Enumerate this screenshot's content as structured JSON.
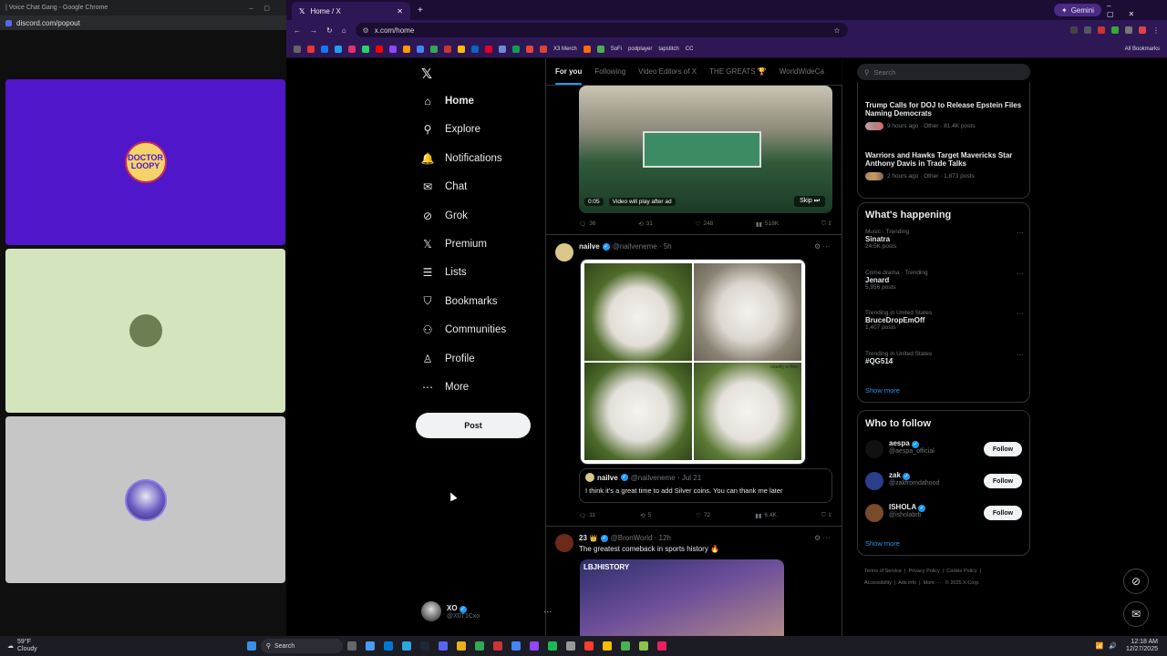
{
  "discord": {
    "title": "| Voice Chat Gang - Google Chrome",
    "url": "discord.com/popout",
    "tiles": [
      {
        "color": "#5016c9",
        "label": "DOCTOR LOOPY"
      },
      {
        "color": "#d4e4bc",
        "label": ""
      },
      {
        "color": "#c6c6c6",
        "label": ""
      }
    ]
  },
  "chrome": {
    "tab_title": "Home / X",
    "url": "x.com/home",
    "gemini_label": "Gemini",
    "bookmarks": [
      "X3 Merch",
      "SoFi",
      "podplayer",
      "tapstitch",
      "CC",
      "All Bookmarks"
    ]
  },
  "x": {
    "nav": [
      {
        "label": "Home",
        "icon": "home-icon"
      },
      {
        "label": "Explore",
        "icon": "search-icon"
      },
      {
        "label": "Notifications",
        "icon": "bell-icon"
      },
      {
        "label": "Chat",
        "icon": "mail-icon"
      },
      {
        "label": "Grok",
        "icon": "grok-icon"
      },
      {
        "label": "Premium",
        "icon": "x-logo-icon"
      },
      {
        "label": "Lists",
        "icon": "list-icon"
      },
      {
        "label": "Bookmarks",
        "icon": "bookmark-icon"
      },
      {
        "label": "Communities",
        "icon": "people-icon"
      },
      {
        "label": "Profile",
        "icon": "person-icon"
      },
      {
        "label": "More",
        "icon": "more-icon"
      }
    ],
    "post_button": "Post",
    "account": {
      "name": "XO",
      "handle": "@X0T1Cxo"
    },
    "feed_tabs": [
      "For you",
      "Following",
      "Video Editors of X",
      "THE GREATS 🏆",
      "WorldWideCa"
    ],
    "post1": {
      "video_time": "0:05",
      "video_note": "Video will play after ad",
      "skip": "Skip",
      "replies": "36",
      "reposts": "31",
      "likes": "248",
      "views": "518K"
    },
    "post2": {
      "name": "nailve",
      "handle": "@nailveneme · 5h",
      "watermark": "cruelty is free",
      "quote_name": "nailve",
      "quote_handle": "@nailveneme · Jul 21",
      "quote_text": "I think it's a great time to add Silver coins. You can thank me later",
      "replies": "11",
      "reposts": "5",
      "likes": "72",
      "views": "6.4K"
    },
    "post3": {
      "name": "23",
      "handle": "@BronWorld · 12h",
      "text": "The greatest comeback in sports history 🔥",
      "image_caption": "LBJHISTORY"
    },
    "search_placeholder": "Search",
    "top_news": [
      {
        "title": "Trump Calls for DOJ to Release Epstein Files Naming Democrats",
        "meta": "9 hours ago · Other · 81.4K posts"
      },
      {
        "title": "Warriors and Hawks Target Mavericks Star Anthony Davis in Trade Talks",
        "meta": "2 hours ago · Other · 1,873 posts"
      }
    ],
    "whats_happening": {
      "title": "What's happening",
      "trends": [
        {
          "meta": "Music · Trending",
          "title": "Sinatra",
          "count": "24.5K posts"
        },
        {
          "meta": "Crime drama · Trending",
          "title": "Jenard",
          "count": "5,956 posts"
        },
        {
          "meta": "Trending in United States",
          "title": "BruceDropEmOff",
          "count": "1,407 posts"
        },
        {
          "meta": "Trending in United States",
          "title": "#QG514",
          "count": ""
        }
      ],
      "show_more": "Show more"
    },
    "who_to_follow": {
      "title": "Who to follow",
      "users": [
        {
          "name": "aespa",
          "handle": "@aespa_official",
          "button": "Follow"
        },
        {
          "name": "zak",
          "handle": "@zakfromdahood",
          "button": "Follow"
        },
        {
          "name": "ISHOLA",
          "handle": "@isholabrb",
          "button": "Follow"
        }
      ],
      "show_more": "Show more"
    },
    "footer": [
      "Terms of Service",
      "Privacy Policy",
      "Cookie Policy",
      "Accessibility",
      "Ads info",
      "More ···",
      "© 2025 X Corp."
    ]
  },
  "taskbar": {
    "weather_temp": "59°F",
    "weather_desc": "Cloudy",
    "search_label": "Search",
    "time": "12:18 AM",
    "date": "12/27/2025"
  },
  "colors": {
    "accent": "#1d9bf0",
    "chrome_purple": "#2d1855",
    "discord_blue": "#5016c9"
  }
}
